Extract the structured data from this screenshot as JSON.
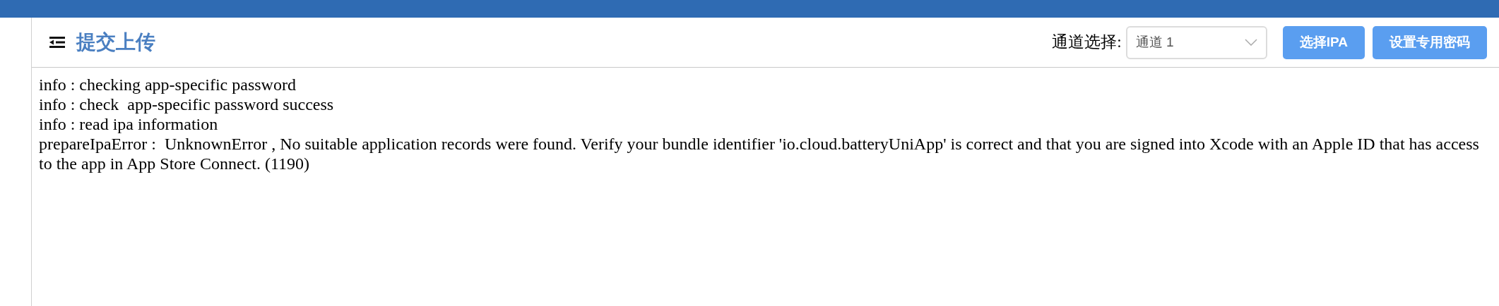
{
  "header": {
    "title": "提交上传"
  },
  "channel": {
    "label": "通道选择:",
    "value": "通道 1"
  },
  "buttons": [
    "选择IPA",
    "设置专用密码"
  ],
  "log": [
    "info : checking app-specific password",
    "info : check  app-specific password success",
    "info : read ipa information",
    "prepareIpaError :  UnknownError , No suitable application records were found. Verify your bundle identifier 'io.cloud.batteryUniApp' is correct and that you are signed into Xcode with an Apple ID that has access to the app in App Store Connect. (1190)"
  ]
}
